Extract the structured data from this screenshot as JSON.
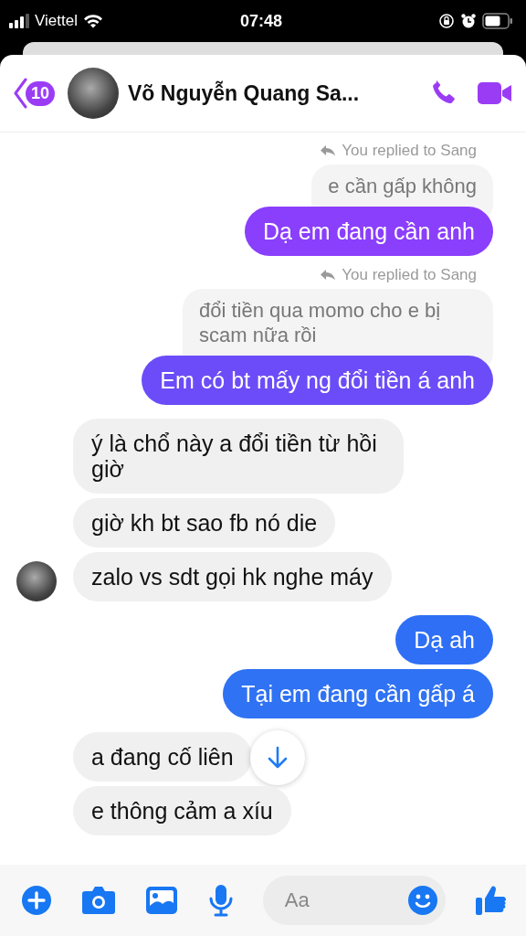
{
  "status_bar": {
    "carrier": "Viettel",
    "time": "07:48"
  },
  "header": {
    "back_count": "10",
    "contact_name": "Võ Nguyễn Quang Sa..."
  },
  "messages": [
    {
      "kind": "reply_note",
      "text": "You replied to Sang"
    },
    {
      "kind": "quoted",
      "text": "e cần gấp không"
    },
    {
      "kind": "sent",
      "text": "Dạ em đang cần anh",
      "color": "#8a3ffc"
    },
    {
      "kind": "reply_note",
      "text": "You replied to Sang"
    },
    {
      "kind": "quoted",
      "text": "đổi tiền qua momo cho e bị scam nữa rồi"
    },
    {
      "kind": "sent",
      "text": "Em có bt mấy ng đổi tiền á anh",
      "color": "#6c4cf8"
    },
    {
      "kind": "received",
      "text": "ý là chổ này a đổi tiền từ hồi giờ",
      "avatar": false
    },
    {
      "kind": "received",
      "text": "giờ kh bt sao fb nó die",
      "avatar": false
    },
    {
      "kind": "received",
      "text": "zalo vs sdt gọi hk nghe máy",
      "avatar": true
    },
    {
      "kind": "sent",
      "text": "Dạ ah",
      "color": "#2f6ff5"
    },
    {
      "kind": "sent",
      "text": "Tại em đang cần gấp á",
      "color": "#2f72f3"
    },
    {
      "kind": "received",
      "text": "a đang cố liên",
      "avatar": false
    },
    {
      "kind": "received",
      "text": "e thông cảm a xíu",
      "avatar": false
    }
  ],
  "composer": {
    "placeholder": "Aa"
  }
}
